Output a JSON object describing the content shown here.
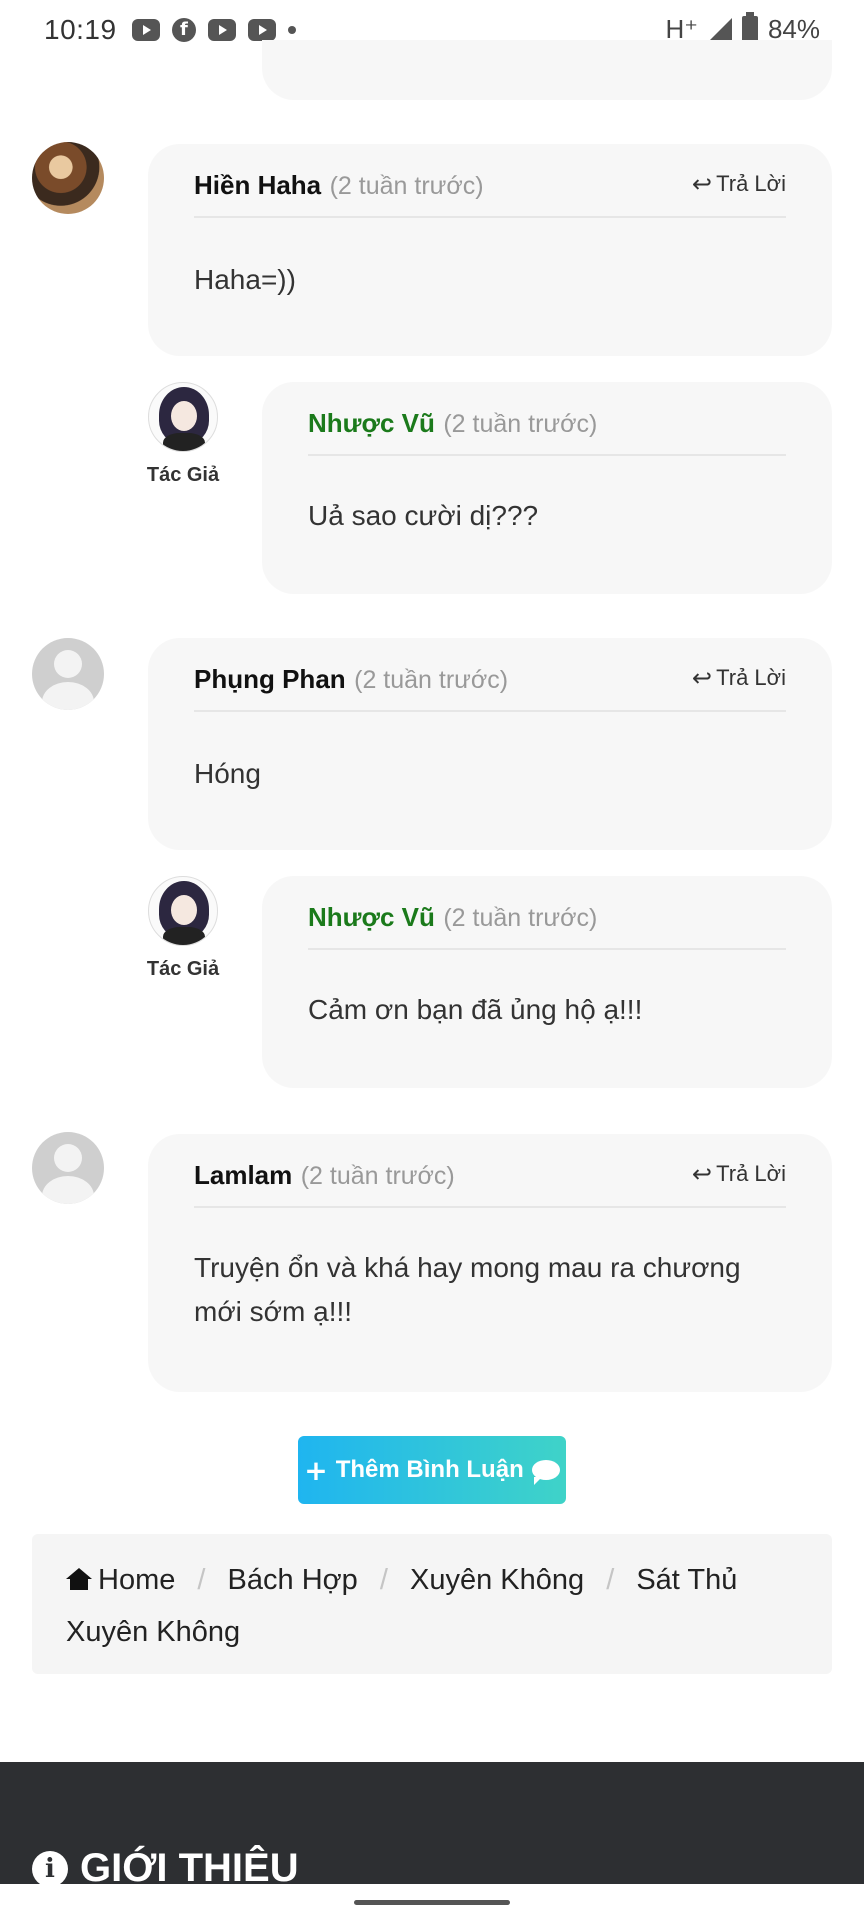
{
  "status_bar": {
    "time": "10:19",
    "network": "H⁺",
    "battery": "84%",
    "notification_icons": [
      "youtube-icon",
      "facebook-icon",
      "youtube-icon",
      "youtube-icon"
    ]
  },
  "comments": [
    {
      "name": "Hiền Haha",
      "time": "(2 tuần trước)",
      "reply_label": "Trả Lời",
      "content": "Haha=))",
      "reply": {
        "name": "Nhược Vũ",
        "time": "(2 tuần trước)",
        "badge": "Tác Giả",
        "content": "Uả sao cười dị???"
      }
    },
    {
      "name": "Phụng Phan",
      "time": "(2 tuần trước)",
      "reply_label": "Trả Lời",
      "content": "Hóng",
      "reply": {
        "name": "Nhược Vũ",
        "time": "(2 tuần trước)",
        "badge": "Tác Giả",
        "content": "Cảm ơn bạn đã ủng hộ ạ!!!"
      }
    },
    {
      "name": "Lamlam",
      "time": "(2 tuần trước)",
      "reply_label": "Trả Lời",
      "content": "Truyện ổn và khá hay mong mau ra chương mới sớm ạ!!!"
    }
  ],
  "add_comment_label": "Thêm Bình Luận",
  "breadcrumb": {
    "home": "Home",
    "items": [
      "Bách Hợp",
      "Xuyên Không",
      "Sát Thủ Xuyên Không"
    ]
  },
  "footer": {
    "title": "GIỚI THIỆU"
  },
  "colors": {
    "author_name": "#1b7a1b",
    "button_start": "#1fb5f0",
    "button_end": "#3fd3c8",
    "footer_bg": "#2d2f32"
  }
}
